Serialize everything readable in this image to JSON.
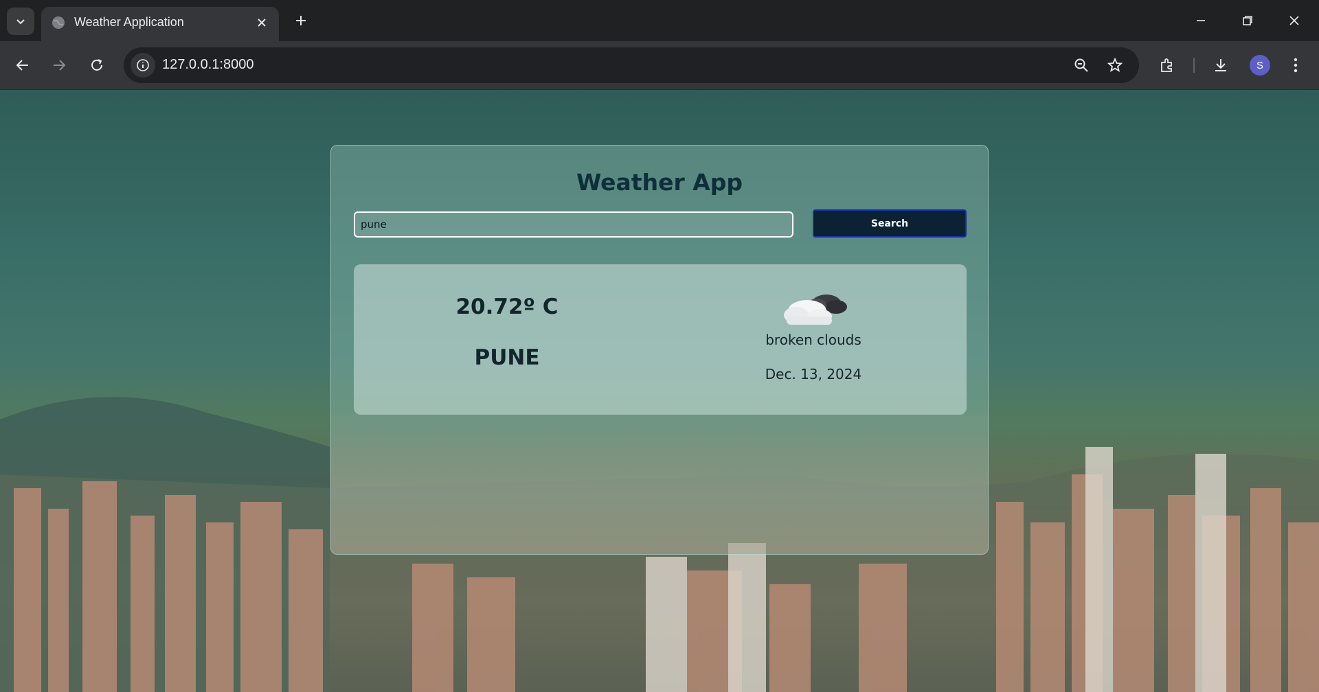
{
  "browser": {
    "tab_title": "Weather Application",
    "url": "127.0.0.1:8000",
    "profile_initial": "S"
  },
  "app": {
    "title": "Weather App",
    "search": {
      "value": "pune",
      "button_label": "Search"
    },
    "result": {
      "temperature": "20.72º C",
      "city": "PUNE",
      "weather_icon": "broken-clouds-icon",
      "description": "broken clouds",
      "date": "Dec. 13, 2024"
    }
  },
  "colors": {
    "title": "#0e2f3a",
    "button_bg": "#0a2233",
    "button_border": "#1a2fa8"
  }
}
